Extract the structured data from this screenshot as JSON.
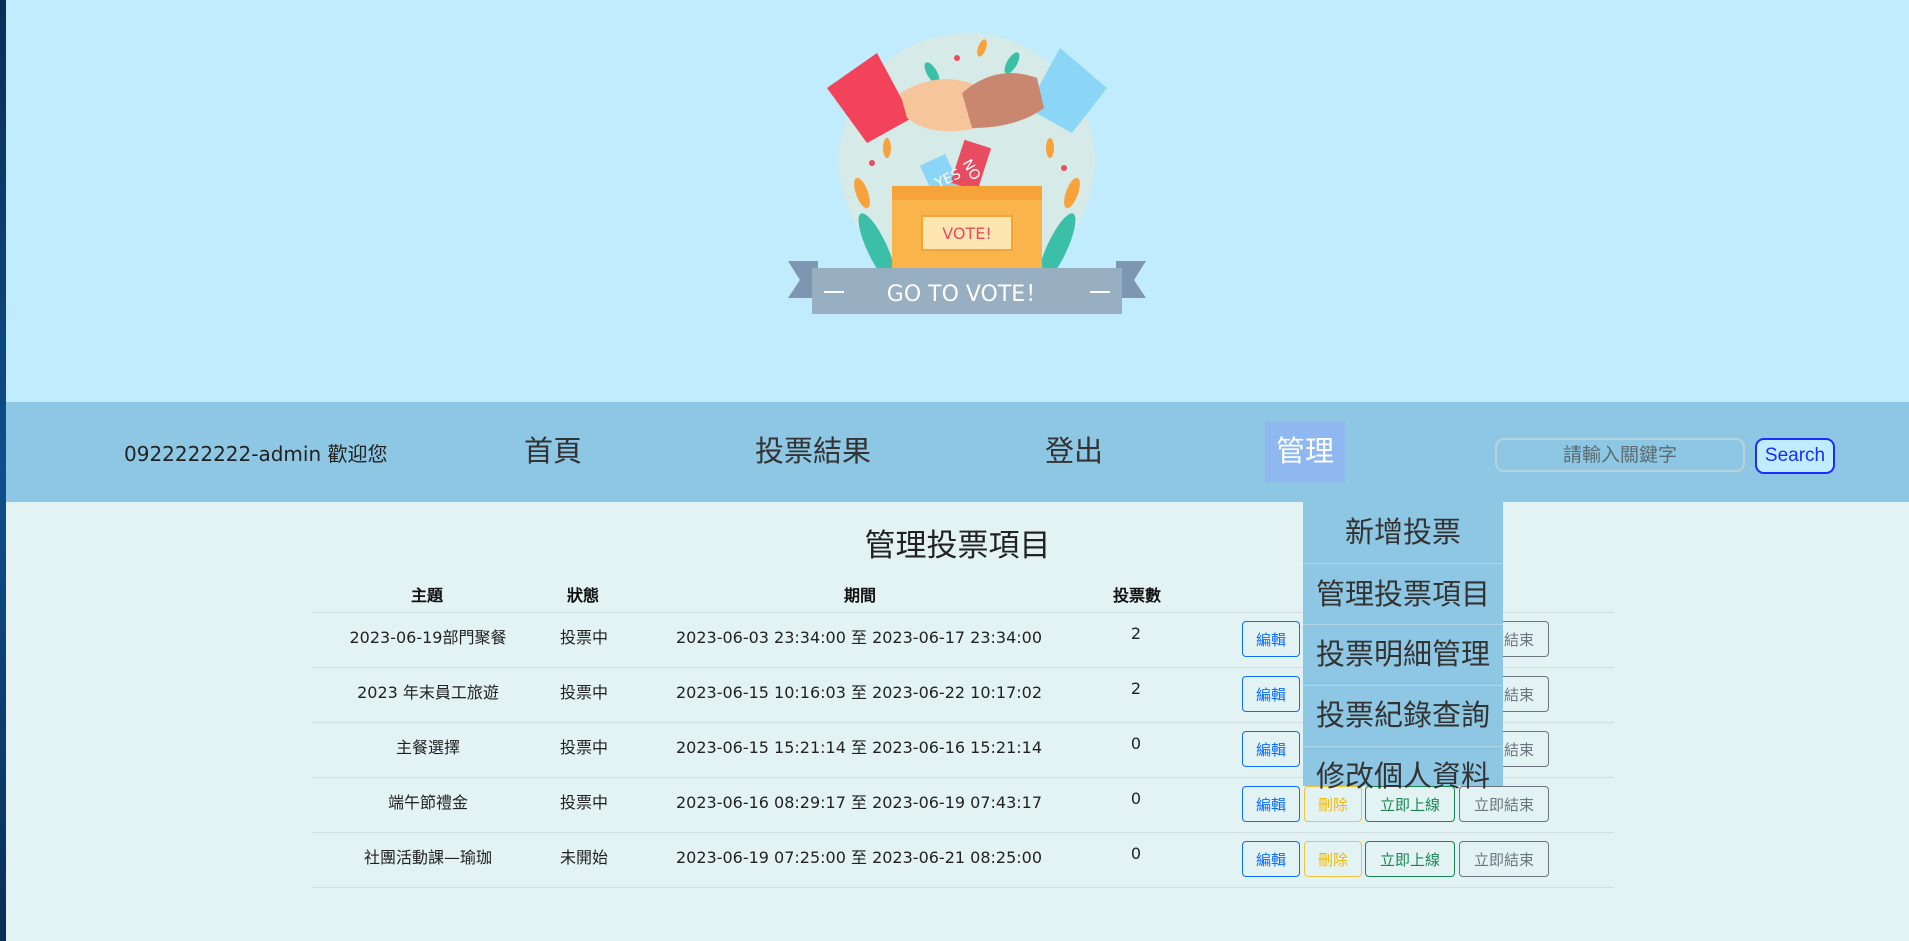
{
  "logo": {
    "box_yes": "YES",
    "box_no": "NO",
    "box_vote": "VOTE!",
    "banner": "GO TO VOTE！"
  },
  "nav": {
    "welcome": "0922222222-admin 歡迎您",
    "home": "首頁",
    "results": "投票結果",
    "logout": "登出",
    "manage": "管理",
    "search_placeholder": "請輸入關鍵字",
    "search_button": "Search"
  },
  "dropdown": {
    "items": [
      "新增投票",
      "管理投票項目",
      "投票明細管理",
      "投票紀錄查詢",
      "修改個人資料"
    ]
  },
  "main": {
    "title": "管理投票項目",
    "headers": {
      "topic": "主題",
      "status": "狀態",
      "period": "期間",
      "votes": "投票數"
    },
    "rows": [
      {
        "topic": "2023-06-19部門聚餐",
        "status": "投票中",
        "period": "2023-06-03 23:34:00 至 2023-06-17 23:34:00",
        "votes": "2"
      },
      {
        "topic": "2023 年末員工旅遊",
        "status": "投票中",
        "period": "2023-06-15 10:16:03 至 2023-06-22 10:17:02",
        "votes": "2"
      },
      {
        "topic": "主餐選擇",
        "status": "投票中",
        "period": "2023-06-15 15:21:14 至 2023-06-16 15:21:14",
        "votes": "0"
      },
      {
        "topic": "端午節禮金",
        "status": "投票中",
        "period": "2023-06-16 08:29:17 至 2023-06-19 07:43:17",
        "votes": "0"
      },
      {
        "topic": "社團活動課—瑜珈",
        "status": "未開始",
        "period": "2023-06-19 07:25:00 至 2023-06-21 08:25:00",
        "votes": "0"
      }
    ],
    "actions": {
      "edit": "編輯",
      "delete": "刪除",
      "online": "立即上線",
      "end": "立即結束"
    }
  },
  "colors": {
    "hero_bg": "#c0ecfd",
    "nav_bg": "#8ec7e3",
    "content_bg": "#e3f2f2",
    "manage_active": "#8fb7f0",
    "btn_primary": "#0d6efd",
    "btn_warning": "#f0b90b",
    "btn_success": "#198754",
    "btn_secondary": "#6c757d"
  }
}
